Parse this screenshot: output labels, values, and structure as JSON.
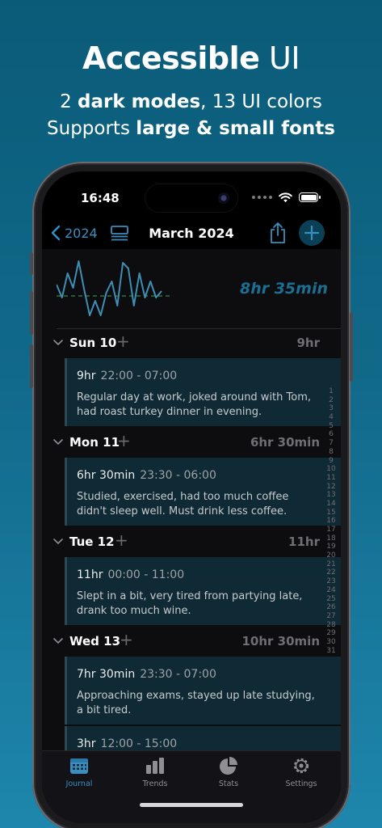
{
  "promo": {
    "title_bold": "Accessible",
    "title_light": "UI",
    "line1_a": "2 ",
    "line1_b": "dark modes",
    "line1_c": ", 13 UI colors",
    "line2_a": "Supports ",
    "line2_b": "large & small fonts"
  },
  "status_bar": {
    "time": "16:48"
  },
  "nav": {
    "back_label": "2024",
    "title": "March 2024",
    "icons": [
      "chevron-left-icon",
      "list-icon",
      "share-icon",
      "plus-icon"
    ]
  },
  "summary": {
    "total": "8hr 35min"
  },
  "days": [
    {
      "name": "Sun 10",
      "total": "9hr",
      "entry": {
        "duration": "9hr",
        "range": "22:00 - 07:00",
        "note": "Regular day at work, joked around with Tom, had roast turkey dinner in evening."
      }
    },
    {
      "name": "Mon 11",
      "total": "6hr 30min",
      "entry": {
        "duration": "6hr 30min",
        "range": "23:30 - 06:00",
        "note": "Studied, exercised, had too much coffee didn't sleep well. Must drink less coffee."
      }
    },
    {
      "name": "Tue 12",
      "total": "11hr",
      "entry": {
        "duration": "11hr",
        "range": "00:00 - 11:00",
        "note": "Slept in a bit, very tired from partying late, drank too much wine."
      }
    },
    {
      "name": "Wed 13",
      "total": "10hr 30min",
      "entry": {
        "duration": "7hr 30min",
        "range": "23:30 - 07:00",
        "note": "Approaching exams, stayed up late studying, a bit tired."
      }
    }
  ],
  "partial_entry": {
    "duration": "3hr",
    "range": "12:00 - 15:00"
  },
  "day_index": [
    "1",
    "2",
    "3",
    "4",
    "5",
    "6",
    "7",
    "8",
    "9",
    "10",
    "11",
    "12",
    "13",
    "14",
    "15",
    "16",
    "17",
    "18",
    "19",
    "20",
    "21",
    "22",
    "23",
    "24",
    "25",
    "26",
    "27",
    "28",
    "29",
    "30",
    "31"
  ],
  "tabs": [
    {
      "label": "Journal",
      "icon": "calendar-icon",
      "active": true
    },
    {
      "label": "Trends",
      "icon": "bar-chart-icon",
      "active": false
    },
    {
      "label": "Stats",
      "icon": "pie-chart-icon",
      "active": false
    },
    {
      "label": "Settings",
      "icon": "gear-icon",
      "active": false
    }
  ],
  "colors": {
    "accent": "#3a8fc0",
    "chart_line": "#3e8fb5",
    "chart_avg": "#2f8a4a",
    "entry_bg": "#0f2a35"
  }
}
